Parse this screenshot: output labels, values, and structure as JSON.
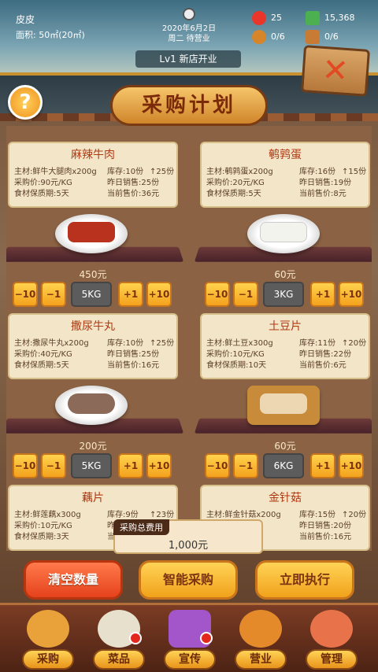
{
  "header": {
    "shop_name": "皮皮",
    "area_label": "面积: 50㎡(20㎡)",
    "date": "2020年6月2日",
    "status": "周二 待营业",
    "level": "Lv1 新店开业",
    "resources": [
      {
        "name": "heart-icon",
        "value": "25",
        "color": "#e8372a"
      },
      {
        "name": "cash-icon",
        "value": "15,368",
        "color": "#4caf50"
      },
      {
        "name": "chef-icon",
        "value": "0/6",
        "color": "#d6852a"
      },
      {
        "name": "box-icon",
        "value": "0/6",
        "color": "#c77b35"
      }
    ]
  },
  "page_title": "采购计划",
  "help_label": "?",
  "close_label": "✕",
  "items": [
    {
      "name": "麻辣牛肉",
      "main": "主材:鲜牛大腿肉x200g",
      "stock": "库存:10份",
      "stock_delta": "↑25份",
      "price": "采购价:90元/KG",
      "sold": "昨日销售:25份",
      "shelf_life": "食材保质期:5天",
      "sale_price": "当前售价:36元",
      "cost": "450元",
      "qty": "5KG",
      "food_color": "#b8321e"
    },
    {
      "name": "鹌鹑蛋",
      "main": "主材:鹌鹑蛋x200g",
      "stock": "库存:16份",
      "stock_delta": "↑15份",
      "price": "采购价:20元/KG",
      "sold": "昨日销售:19份",
      "shelf_life": "食材保质期:5天",
      "sale_price": "当前售价:8元",
      "cost": "60元",
      "qty": "3KG",
      "food_color": "#f3f3ee"
    },
    {
      "name": "撒尿牛丸",
      "main": "主材:撒尿牛丸x200g",
      "stock": "库存:10份",
      "stock_delta": "↑25份",
      "price": "采购价:40元/KG",
      "sold": "昨日销售:25份",
      "shelf_life": "食材保质期:5天",
      "sale_price": "当前售价:16元",
      "cost": "200元",
      "qty": "5KG",
      "food_color": "#8b6a5a"
    },
    {
      "name": "土豆片",
      "main": "主材:鲜土豆x300g",
      "stock": "库存:11份",
      "stock_delta": "↑20份",
      "price": "采购价:10元/KG",
      "sold": "昨日销售:22份",
      "shelf_life": "食材保质期:10天",
      "sale_price": "当前售价:6元",
      "cost": "60元",
      "qty": "6KG",
      "food_color": "#ecd7b2"
    },
    {
      "name": "藕片",
      "main": "主材:鲜莲藕x300g",
      "stock": "库存:9份",
      "stock_delta": "↑23份",
      "price": "采购价:10元/KG",
      "sold": "昨",
      "shelf_life": "食材保质期:3天",
      "sale_price": "当",
      "cost": "",
      "qty": "",
      "food_color": "#e9dcc4"
    },
    {
      "name": "金针菇",
      "main": "主材:鲜金针菇x200g",
      "stock": "库存:15份",
      "stock_delta": "↑20份",
      "price": "",
      "sold": "昨日销售:20份",
      "shelf_life": "",
      "sale_price": "当前售价:16元",
      "cost": "",
      "qty": "",
      "food_color": "#f2eedb"
    }
  ],
  "buttons": {
    "minus10": "−10",
    "minus1": "−1",
    "plus1": "+1",
    "plus10": "+10"
  },
  "total": {
    "label": "采购总费用",
    "value": "1,000元"
  },
  "actions": [
    {
      "label": "清空数量"
    },
    {
      "label": "智能采购"
    },
    {
      "label": "立即执行"
    }
  ],
  "nav": [
    {
      "label": "采购",
      "icon": "shop-icon",
      "color": "#e9a23a"
    },
    {
      "label": "菜品",
      "icon": "dish-icon",
      "color": "#e7e0cc"
    },
    {
      "label": "宣传",
      "icon": "video-icon",
      "color": "#a356c9"
    },
    {
      "label": "营业",
      "icon": "cloche-icon",
      "color": "#e48a2a"
    },
    {
      "label": "管理",
      "icon": "staff-icon",
      "color": "#e8734a"
    }
  ]
}
